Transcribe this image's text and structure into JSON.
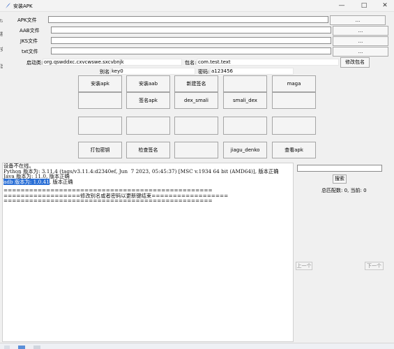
{
  "window": {
    "title": "安装APK",
    "minimize": "—",
    "maximize": "□",
    "close": "✕"
  },
  "files": [
    {
      "label": "APK文件",
      "value": "",
      "button": "..."
    },
    {
      "label": "AAB文件",
      "value": "",
      "button": "..."
    },
    {
      "label": "JKS文件",
      "value": "",
      "button": "..."
    },
    {
      "label": "txt文件",
      "value": "",
      "button": "..."
    }
  ],
  "package": {
    "launch_label": "启动类:",
    "launch_value": "org.qswddxc.cxvcwswe.sxcvbnjk",
    "name_label": "包名:",
    "name_value": "com.test.text",
    "modify_button": "修改包名",
    "alias_label": "别名:",
    "alias_value": "key0",
    "password_label": "密码:",
    "password_value": "a123456"
  },
  "grid": [
    [
      "安装apk",
      "安装aab",
      "新建签名",
      "",
      "maga"
    ],
    [
      "",
      "签名apk",
      "dex_smali",
      "smali_dex",
      ""
    ],
    [
      "",
      "",
      "",
      "",
      ""
    ],
    [
      "打包密钥",
      "检查签名",
      "",
      "jiagu_denko",
      "查看apk"
    ]
  ],
  "console": {
    "lines": [
      {
        "text": "设备不在线。"
      },
      {
        "text": "Python 版本为: 3.11.4 (tags/v3.11.4:d2340ef, Jun  7 2023, 05:45:37) [MSC v.1934 64 bit (AMD64)], 版本正确"
      },
      {
        "text": "Java 版本为: 11.0, 版本正确"
      },
      {
        "highlight": "adb 版本为: 1.0.41",
        "rest": ", 版本正确"
      },
      {
        "text": "================================================="
      },
      {
        "text": "==================修改别名或者密码以更新键结束=================="
      },
      {
        "text": "================================================="
      }
    ]
  },
  "search": {
    "input_value": "",
    "button": "搜索",
    "count_text": "总匹配数: 0, 当前: 0",
    "prev": "上一个",
    "next": "下一个"
  },
  "left_edge": [
    "ta",
    "斟",
    "安",
    "旨"
  ]
}
